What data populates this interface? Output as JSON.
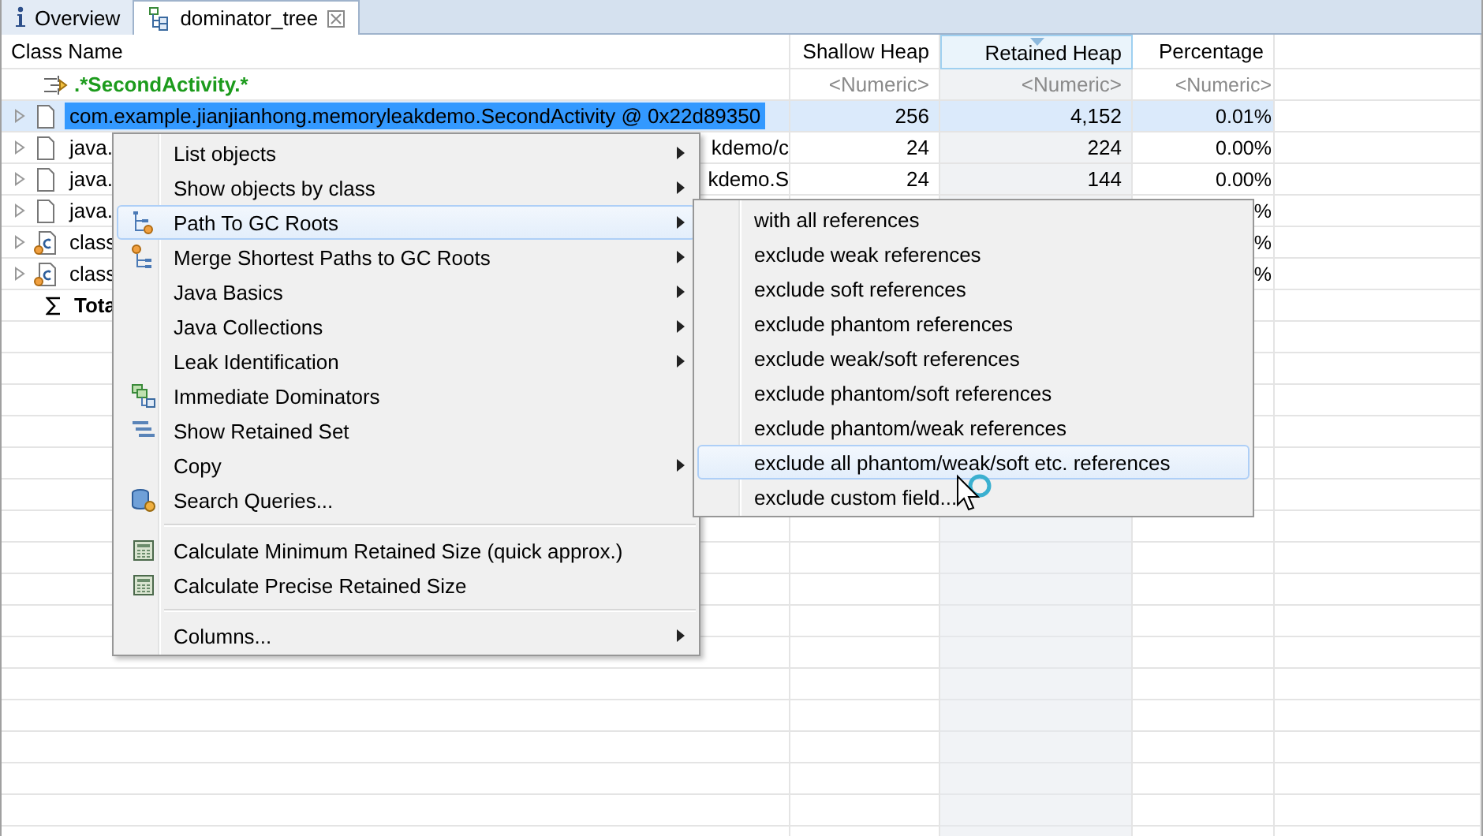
{
  "tabs": [
    {
      "label": "Overview",
      "selected": false,
      "kind": "info"
    },
    {
      "label": "dominator_tree",
      "selected": true,
      "kind": "tree",
      "closable": true
    }
  ],
  "table": {
    "columns": [
      {
        "label": "Class Name",
        "sorted": false
      },
      {
        "label": "Shallow Heap",
        "sorted": false
      },
      {
        "label": "Retained Heap",
        "sorted": true
      },
      {
        "label": "Percentage",
        "sorted": false
      }
    ],
    "filter_row": {
      "pattern": ".*SecondActivity.*",
      "cells": [
        "<Numeric>",
        "<Numeric>",
        "<Numeric>"
      ]
    },
    "rows": [
      {
        "kind": "object",
        "name": "com.example.jianjianhong.memoryleakdemo.SecondActivity @ 0x22d89350",
        "name_tail": "",
        "shallow": "256",
        "retained": "4,152",
        "percentage": "0.01%",
        "selected": true
      },
      {
        "kind": "object",
        "name": "java.",
        "name_tail": "kdemo/c",
        "shallow": "24",
        "retained": "224",
        "percentage": "0.00%",
        "selected": false
      },
      {
        "kind": "object",
        "name": "java.",
        "name_tail": "kdemo.S",
        "shallow": "24",
        "retained": "144",
        "percentage": "0.00%",
        "selected": false
      },
      {
        "kind": "object",
        "name": "java.",
        "name_tail": "",
        "shallow": "",
        "retained": "",
        "percentage": "%",
        "selected": false
      },
      {
        "kind": "class",
        "name": "class",
        "name_tail": "",
        "shallow": "",
        "retained": "",
        "percentage": "%",
        "selected": false
      },
      {
        "kind": "class",
        "name": "class",
        "name_tail": "",
        "shallow": "",
        "retained": "",
        "percentage": "%",
        "selected": false
      }
    ],
    "total": {
      "label": "Tota"
    }
  },
  "context_menu": {
    "items": [
      {
        "kind": "item",
        "label": "List objects",
        "submenu": true,
        "selected": false
      },
      {
        "kind": "item",
        "label": "Show objects by class",
        "submenu": true,
        "selected": false
      },
      {
        "kind": "item",
        "label": "Path To GC Roots",
        "submenu": true,
        "selected": true
      },
      {
        "kind": "item",
        "label": "Merge Shortest Paths to GC Roots",
        "submenu": true,
        "selected": false
      },
      {
        "kind": "item",
        "label": "Java Basics",
        "submenu": true,
        "selected": false
      },
      {
        "kind": "item",
        "label": "Java Collections",
        "submenu": true,
        "selected": false
      },
      {
        "kind": "item",
        "label": "Leak Identification",
        "submenu": true,
        "selected": false
      },
      {
        "kind": "item",
        "label": "Immediate Dominators",
        "submenu": false,
        "selected": false
      },
      {
        "kind": "item",
        "label": "Show Retained Set",
        "submenu": false,
        "selected": false
      },
      {
        "kind": "item",
        "label": "Copy",
        "submenu": true,
        "selected": false
      },
      {
        "kind": "item",
        "label": "Search Queries...",
        "submenu": false,
        "selected": false
      },
      {
        "kind": "separator"
      },
      {
        "kind": "item",
        "label": "Calculate Minimum Retained Size (quick approx.)",
        "submenu": false,
        "selected": false
      },
      {
        "kind": "item",
        "label": "Calculate Precise Retained Size",
        "submenu": false,
        "selected": false
      },
      {
        "kind": "separator"
      },
      {
        "kind": "item",
        "label": "Columns...",
        "submenu": true,
        "selected": false
      }
    ]
  },
  "submenu": {
    "items": [
      {
        "label": "with all references",
        "selected": false
      },
      {
        "label": "exclude weak references",
        "selected": false
      },
      {
        "label": "exclude soft references",
        "selected": false
      },
      {
        "label": "exclude phantom references",
        "selected": false
      },
      {
        "label": "exclude weak/soft references",
        "selected": false
      },
      {
        "label": "exclude phantom/soft references",
        "selected": false
      },
      {
        "label": "exclude phantom/weak references",
        "selected": false
      },
      {
        "label": "exclude all phantom/weak/soft etc. references",
        "selected": true
      },
      {
        "label": "exclude custom field...",
        "selected": false
      }
    ]
  }
}
